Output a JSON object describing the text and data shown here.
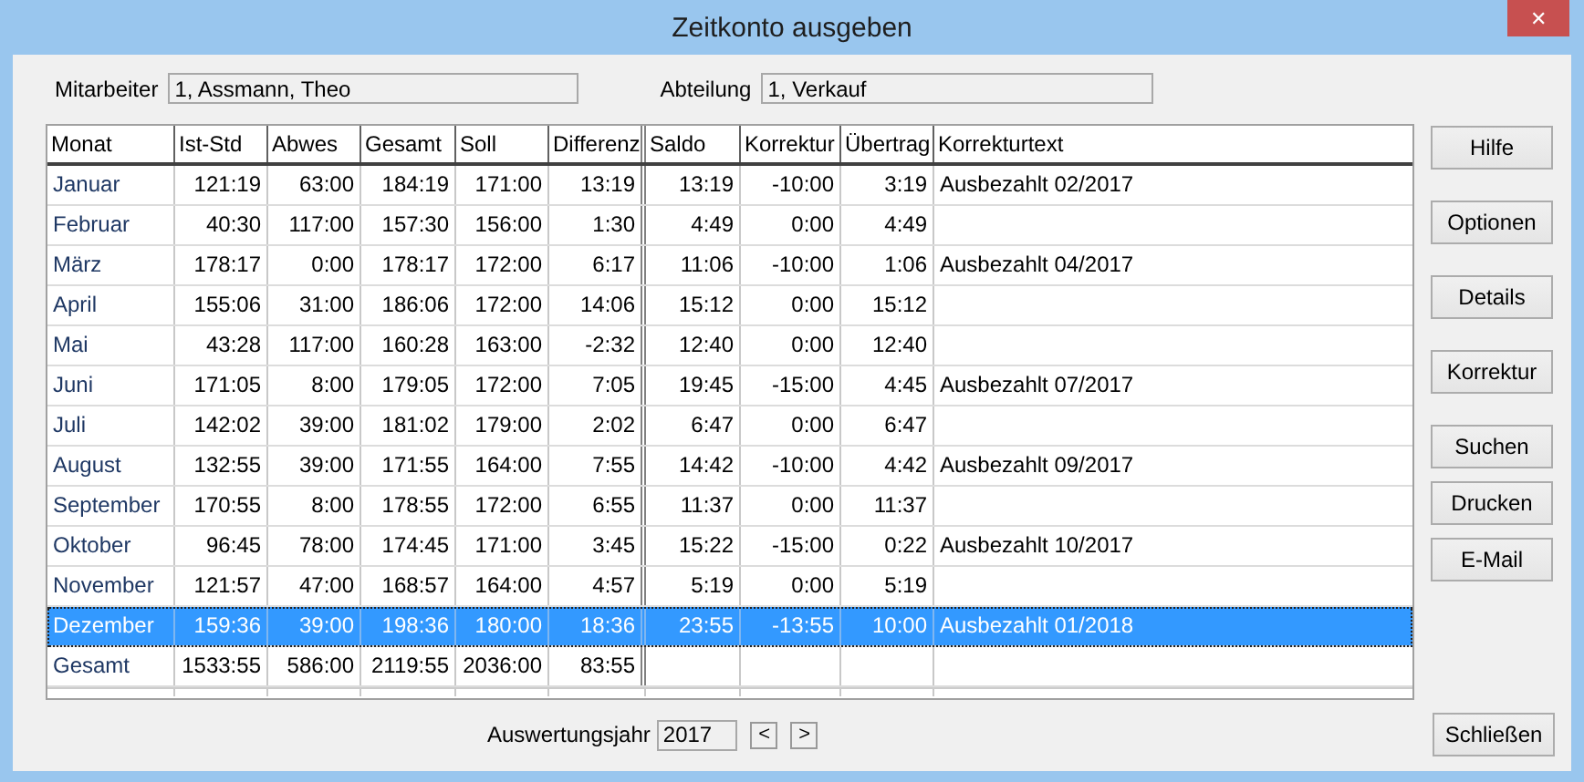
{
  "window": {
    "title": "Zeitkonto ausgeben",
    "close_icon": "✕"
  },
  "employee": {
    "label": "Mitarbeiter",
    "value": "1, Assmann, Theo"
  },
  "department": {
    "label": "Abteilung",
    "value": "1, Verkauf"
  },
  "table": {
    "columns": [
      "Monat",
      "Ist-Std",
      "Abwes",
      "Gesamt",
      "Soll",
      "Differenz",
      "Saldo",
      "Korrektur",
      "Übertrag",
      "Korrekturtext"
    ],
    "rows": [
      {
        "cells": [
          "Januar",
          "121:19",
          "63:00",
          "184:19",
          "171:00",
          "13:19",
          "13:19",
          "-10:00",
          "3:19",
          "Ausbezahlt 02/2017"
        ],
        "selected": false
      },
      {
        "cells": [
          "Februar",
          "40:30",
          "117:00",
          "157:30",
          "156:00",
          "1:30",
          "4:49",
          "0:00",
          "4:49"
        ],
        "selected": false
      },
      {
        "cells": [
          "März",
          "178:17",
          "0:00",
          "178:17",
          "172:00",
          "6:17",
          "11:06",
          "-10:00",
          "1:06",
          "Ausbezahlt 04/2017"
        ],
        "selected": false
      },
      {
        "cells": [
          "April",
          "155:06",
          "31:00",
          "186:06",
          "172:00",
          "14:06",
          "15:12",
          "0:00",
          "15:12"
        ],
        "selected": false
      },
      {
        "cells": [
          "Mai",
          "43:28",
          "117:00",
          "160:28",
          "163:00",
          "-2:32",
          "12:40",
          "0:00",
          "12:40"
        ],
        "selected": false
      },
      {
        "cells": [
          "Juni",
          "171:05",
          "8:00",
          "179:05",
          "172:00",
          "7:05",
          "19:45",
          "-15:00",
          "4:45",
          "Ausbezahlt 07/2017"
        ],
        "selected": false
      },
      {
        "cells": [
          "Juli",
          "142:02",
          "39:00",
          "181:02",
          "179:00",
          "2:02",
          "6:47",
          "0:00",
          "6:47"
        ],
        "selected": false
      },
      {
        "cells": [
          "August",
          "132:55",
          "39:00",
          "171:55",
          "164:00",
          "7:55",
          "14:42",
          "-10:00",
          "4:42",
          "Ausbezahlt 09/2017"
        ],
        "selected": false
      },
      {
        "cells": [
          "September",
          "170:55",
          "8:00",
          "178:55",
          "172:00",
          "6:55",
          "11:37",
          "0:00",
          "11:37"
        ],
        "selected": false
      },
      {
        "cells": [
          "Oktober",
          "96:45",
          "78:00",
          "174:45",
          "171:00",
          "3:45",
          "15:22",
          "-15:00",
          "0:22",
          "Ausbezahlt 10/2017"
        ],
        "selected": false
      },
      {
        "cells": [
          "November",
          "121:57",
          "47:00",
          "168:57",
          "164:00",
          "4:57",
          "5:19",
          "0:00",
          "5:19"
        ],
        "selected": false
      },
      {
        "cells": [
          "Dezember",
          "159:36",
          "39:00",
          "198:36",
          "180:00",
          "18:36",
          "23:55",
          "-13:55",
          "10:00",
          "Ausbezahlt 01/2018"
        ],
        "selected": true
      }
    ],
    "total_row": {
      "cells": [
        "Gesamt",
        "1533:55",
        "586:00",
        "2119:55",
        "2036:00",
        "83:55"
      ]
    }
  },
  "side_buttons": [
    {
      "label": "Hilfe"
    },
    {
      "label": "Optionen"
    },
    {
      "label": "Details"
    },
    {
      "label": "Korrektur"
    },
    {
      "label": "Suchen"
    },
    {
      "label": "Drucken"
    },
    {
      "label": "E-Mail"
    }
  ],
  "year": {
    "label": "Auswertungsjahr",
    "value": "2017",
    "prev": "<",
    "next": ">"
  },
  "close_button": {
    "label": "Schließen"
  }
}
